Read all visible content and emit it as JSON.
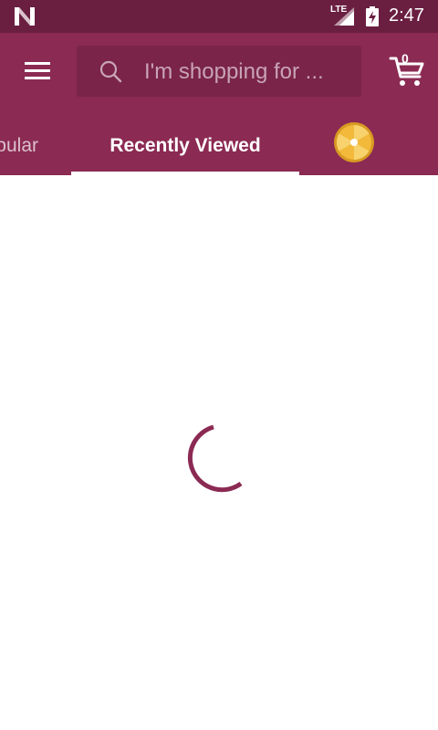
{
  "status_bar": {
    "network_type": "LTE",
    "time": "2:47",
    "icons": [
      "n-logo-icon",
      "signal-icon",
      "battery-charging-icon"
    ]
  },
  "header": {
    "search": {
      "placeholder": "I'm shopping for ..."
    },
    "cart": {
      "count": "0"
    },
    "icons": [
      "hamburger-menu-icon",
      "search-icon",
      "cart-icon"
    ]
  },
  "tabs": [
    {
      "label": "Popular",
      "visible_text": "pular",
      "selected": false
    },
    {
      "label": "Recently Viewed",
      "selected": true
    },
    {
      "label": "",
      "icon": "prize-wheel-icon",
      "selected": false
    }
  ],
  "content": {
    "state": "loading",
    "spinner_icon": "loading-spinner-icon"
  },
  "colors": {
    "status_bar": "#6a1f41",
    "app_bar": "#8b2a53",
    "search_bg": "#7a2449",
    "accent": "#8b2a53",
    "wheel_gold": "#f2b93b",
    "background": "#ffffff"
  }
}
